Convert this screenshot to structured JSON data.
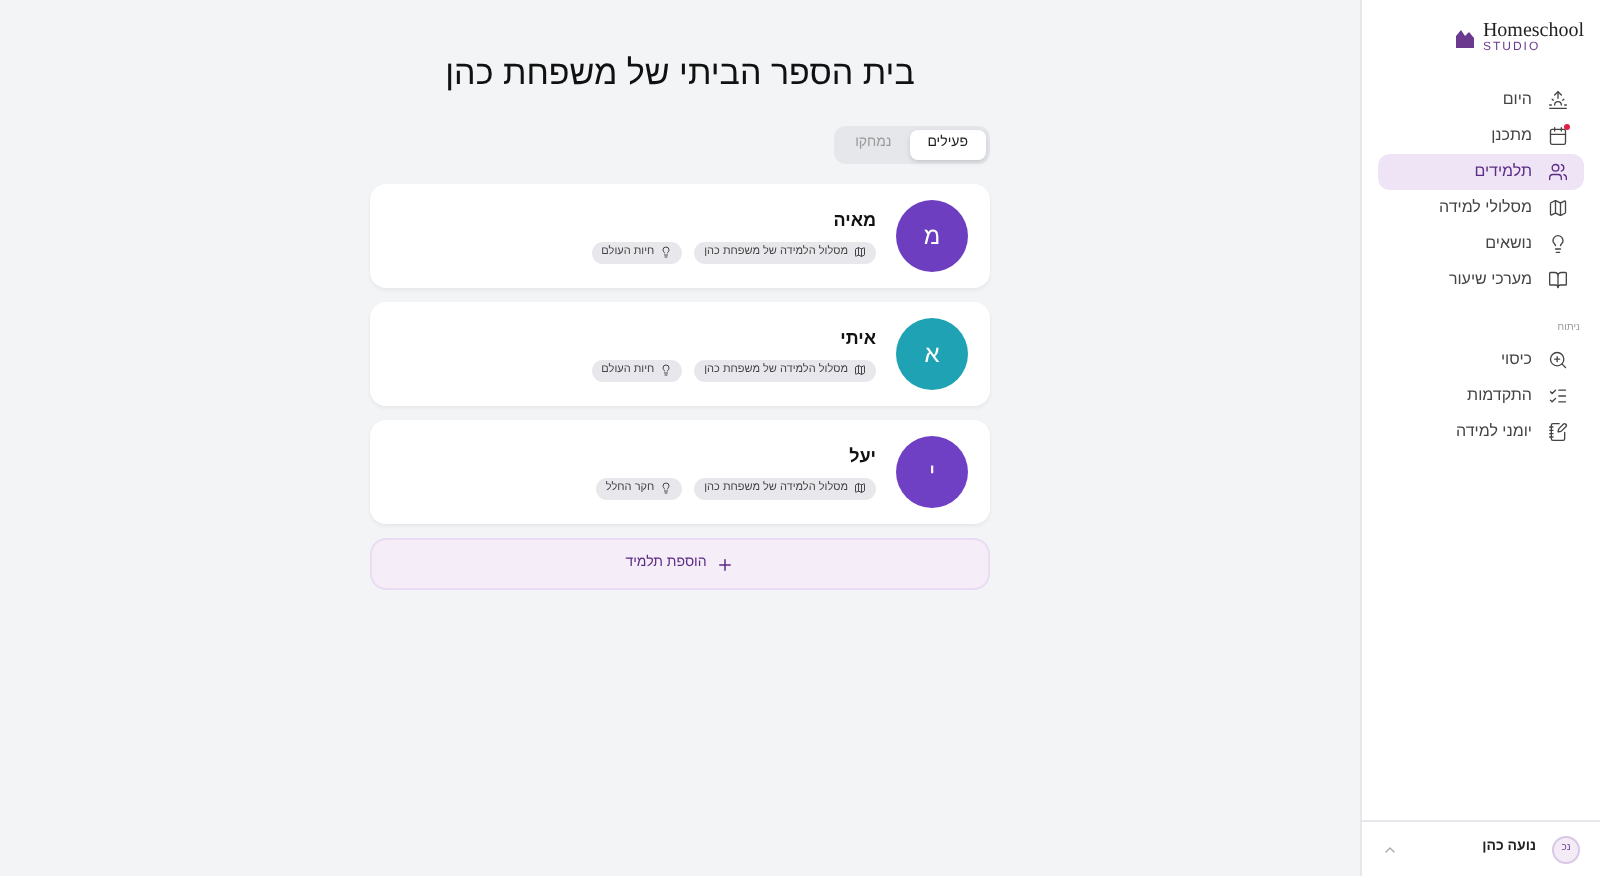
{
  "sidebar": {
    "logo": {
      "name": "Homeschool",
      "sub": "STUDIO"
    },
    "items": [
      {
        "label": "היום",
        "kind": "today",
        "selected": false,
        "badge": false
      },
      {
        "label": "מתכנן",
        "kind": "planner",
        "selected": false,
        "badge": true
      },
      {
        "label": "תלמידים",
        "kind": "students",
        "selected": true,
        "badge": false
      },
      {
        "label": "מסלולי למידה",
        "kind": "paths",
        "selected": false,
        "badge": false
      },
      {
        "label": "נושאים",
        "kind": "topics",
        "selected": false,
        "badge": false
      },
      {
        "label": "מערכי שיעור",
        "kind": "lessons",
        "selected": false,
        "badge": false
      }
    ],
    "section": "ניתוח",
    "section_items": [
      {
        "label": "כיסוי",
        "kind": "coverage",
        "selected": false,
        "badge": false
      },
      {
        "label": "התקדמות",
        "kind": "progress",
        "selected": false,
        "badge": false
      },
      {
        "label": "יומני למידה",
        "kind": "journals",
        "selected": false,
        "badge": false
      }
    ],
    "user": {
      "initials": "נכ",
      "name": "נועה כהן"
    }
  },
  "main": {
    "title": "בית הספר הביתי של משפחת כהן",
    "tabs": [
      {
        "label": "פעילים",
        "selected": true
      },
      {
        "label": "נמחקו",
        "selected": false
      }
    ],
    "students": [
      {
        "name": "מאיה",
        "initial": "מ",
        "color": "#6d3fc0",
        "tags": [
          {
            "kind": "path",
            "label": "מסלול הלמידה של משפחת כהן"
          },
          {
            "kind": "topic",
            "label": "חיות העולם"
          }
        ]
      },
      {
        "name": "איתי",
        "initial": "א",
        "color": "#1fa3b4",
        "tags": [
          {
            "kind": "path",
            "label": "מסלול הלמידה של משפחת כהן"
          },
          {
            "kind": "topic",
            "label": "חיות העולם"
          }
        ]
      },
      {
        "name": "יעל",
        "initial": "י",
        "color": "#7040c4",
        "tags": [
          {
            "kind": "path",
            "label": "מסלול הלמידה של משפחת כהן"
          },
          {
            "kind": "topic",
            "label": "חקר החלל"
          }
        ]
      }
    ],
    "add_button": "הוספת תלמיד"
  }
}
